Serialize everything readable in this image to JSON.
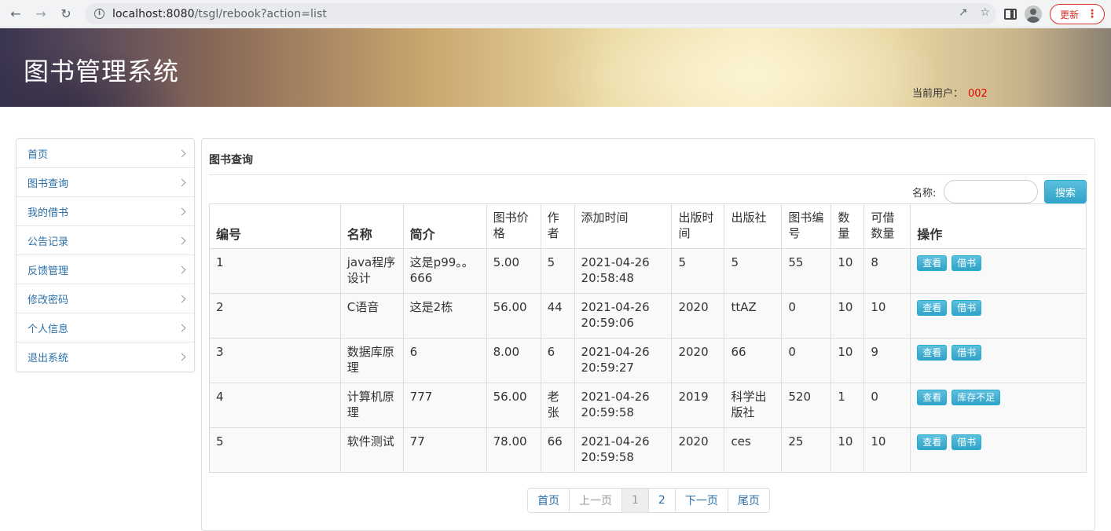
{
  "browser": {
    "url_host": "localhost:8080",
    "url_path": "/tsgl/rebook?action=list",
    "update_label": "更新"
  },
  "header": {
    "site_title": "图书管理系统",
    "current_user_label": "当前用户：",
    "current_user_id": "002"
  },
  "sidebar": {
    "items": [
      {
        "label": "首页"
      },
      {
        "label": "图书查询"
      },
      {
        "label": "我的借书"
      },
      {
        "label": "公告记录"
      },
      {
        "label": "反馈管理"
      },
      {
        "label": "修改密码"
      },
      {
        "label": "个人信息"
      },
      {
        "label": "退出系统"
      }
    ]
  },
  "main": {
    "panel_title": "图书查询",
    "search_label": "名称:",
    "search_value": "",
    "search_button": "搜索",
    "columns": [
      "编号",
      "名称",
      "简介",
      "图书价格",
      "作者",
      "添加时间",
      "出版时间",
      "出版社",
      "图书编号",
      "数量",
      "可借数量",
      "操作"
    ],
    "rows": [
      {
        "id": "1",
        "name": "java程序设计",
        "intro": "这是p99。。666",
        "price": "5.00",
        "author": "5",
        "added": "2021-04-26 20:58:48",
        "pubtime": "5",
        "publisher": "5",
        "bookno": "55",
        "qty": "10",
        "avail": "8",
        "actions": [
          "查看",
          "借书"
        ]
      },
      {
        "id": "2",
        "name": "C语音",
        "intro": "这是2栋",
        "price": "56.00",
        "author": "44",
        "added": "2021-04-26 20:59:06",
        "pubtime": "2020",
        "publisher": "ttAZ",
        "bookno": "0",
        "qty": "10",
        "avail": "10",
        "actions": [
          "查看",
          "借书"
        ]
      },
      {
        "id": "3",
        "name": "数据库原理",
        "intro": "6",
        "price": "8.00",
        "author": "6",
        "added": "2021-04-26 20:59:27",
        "pubtime": "2020",
        "publisher": "66",
        "bookno": "0",
        "qty": "10",
        "avail": "9",
        "actions": [
          "查看",
          "借书"
        ]
      },
      {
        "id": "4",
        "name": "计算机原理",
        "intro": "777",
        "price": "56.00",
        "author": "老张",
        "added": "2021-04-26 20:59:58",
        "pubtime": "2019",
        "publisher": "科学出版社",
        "bookno": "520",
        "qty": "1",
        "avail": "0",
        "actions": [
          "查看",
          "库存不足"
        ]
      },
      {
        "id": "5",
        "name": "软件测试",
        "intro": "77",
        "price": "78.00",
        "author": "66",
        "added": "2021-04-26 20:59:58",
        "pubtime": "2020",
        "publisher": "ces",
        "bookno": "25",
        "qty": "10",
        "avail": "10",
        "actions": [
          "查看",
          "借书"
        ]
      }
    ],
    "pagination": {
      "first": "首页",
      "prev": "上一页",
      "pages": [
        "1",
        "2"
      ],
      "current": "1",
      "next": "下一页",
      "last": "尾页"
    }
  },
  "colors": {
    "link": "#2a6fa8",
    "button": "#31a3c8",
    "user_id": "#e60000"
  }
}
